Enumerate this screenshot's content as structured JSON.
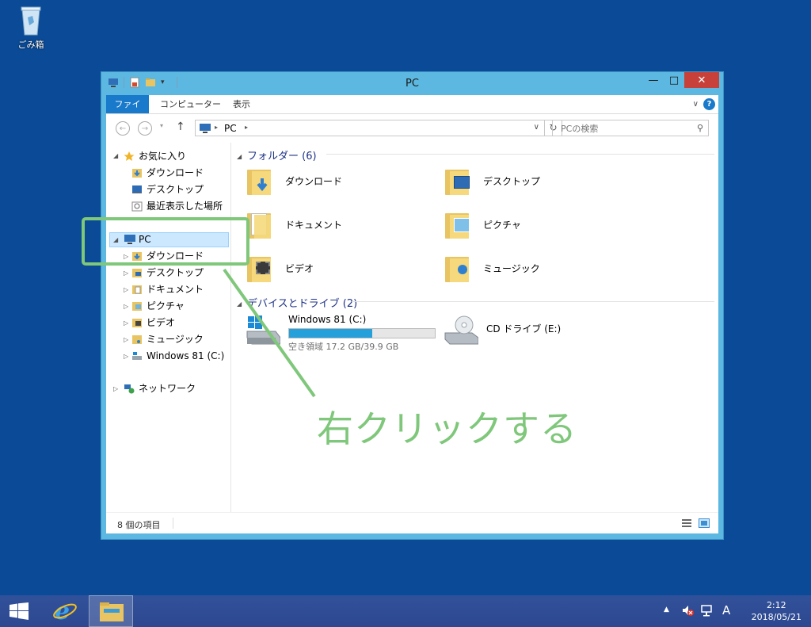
{
  "desktop": {
    "recycle_bin_label": "ごみ箱"
  },
  "window": {
    "title": "PC",
    "controls": {
      "minimize": "—",
      "maximize": "□",
      "close": "✕"
    },
    "ribbon": {
      "tabs": [
        "ファイル",
        "コンピューター",
        "表示"
      ],
      "help": "?"
    },
    "address": {
      "path_icon": "pc-icon",
      "path": "PC",
      "search_placeholder": "PCの検索"
    },
    "nav": {
      "favorites_label": "お気に入り",
      "favorites": [
        "ダウンロード",
        "デスクトップ",
        "最近表示した場所"
      ],
      "pc_label": "PC",
      "pc_children": [
        "ダウンロード",
        "デスクトップ",
        "ドキュメント",
        "ピクチャ",
        "ビデオ",
        "ミュージック",
        "Windows 81 (C:)"
      ],
      "network_label": "ネットワーク"
    },
    "folders_group": {
      "title": "フォルダー (6)",
      "items": [
        {
          "name": "ダウンロード",
          "icon": "download-folder-icon"
        },
        {
          "name": "デスクトップ",
          "icon": "desktop-folder-icon"
        },
        {
          "name": "ドキュメント",
          "icon": "documents-folder-icon"
        },
        {
          "name": "ピクチャ",
          "icon": "pictures-folder-icon"
        },
        {
          "name": "ビデオ",
          "icon": "videos-folder-icon"
        },
        {
          "name": "ミュージック",
          "icon": "music-folder-icon"
        }
      ]
    },
    "drives_group": {
      "title": "デバイスとドライブ (2)",
      "drive_c": {
        "name": "Windows 81 (C:)",
        "free": "空き領域 17.2 GB/39.9 GB",
        "used_fraction": 0.57
      },
      "drive_e": {
        "name": "CD ドライブ (E:)"
      }
    },
    "status": {
      "items_count": "8 個の項目"
    }
  },
  "taskbar": {
    "tray_ime": "A",
    "clock_time": "2:12",
    "clock_date": "2018/05/21"
  },
  "annotation": {
    "text": "右クリックする",
    "color": "#7fc77a"
  }
}
